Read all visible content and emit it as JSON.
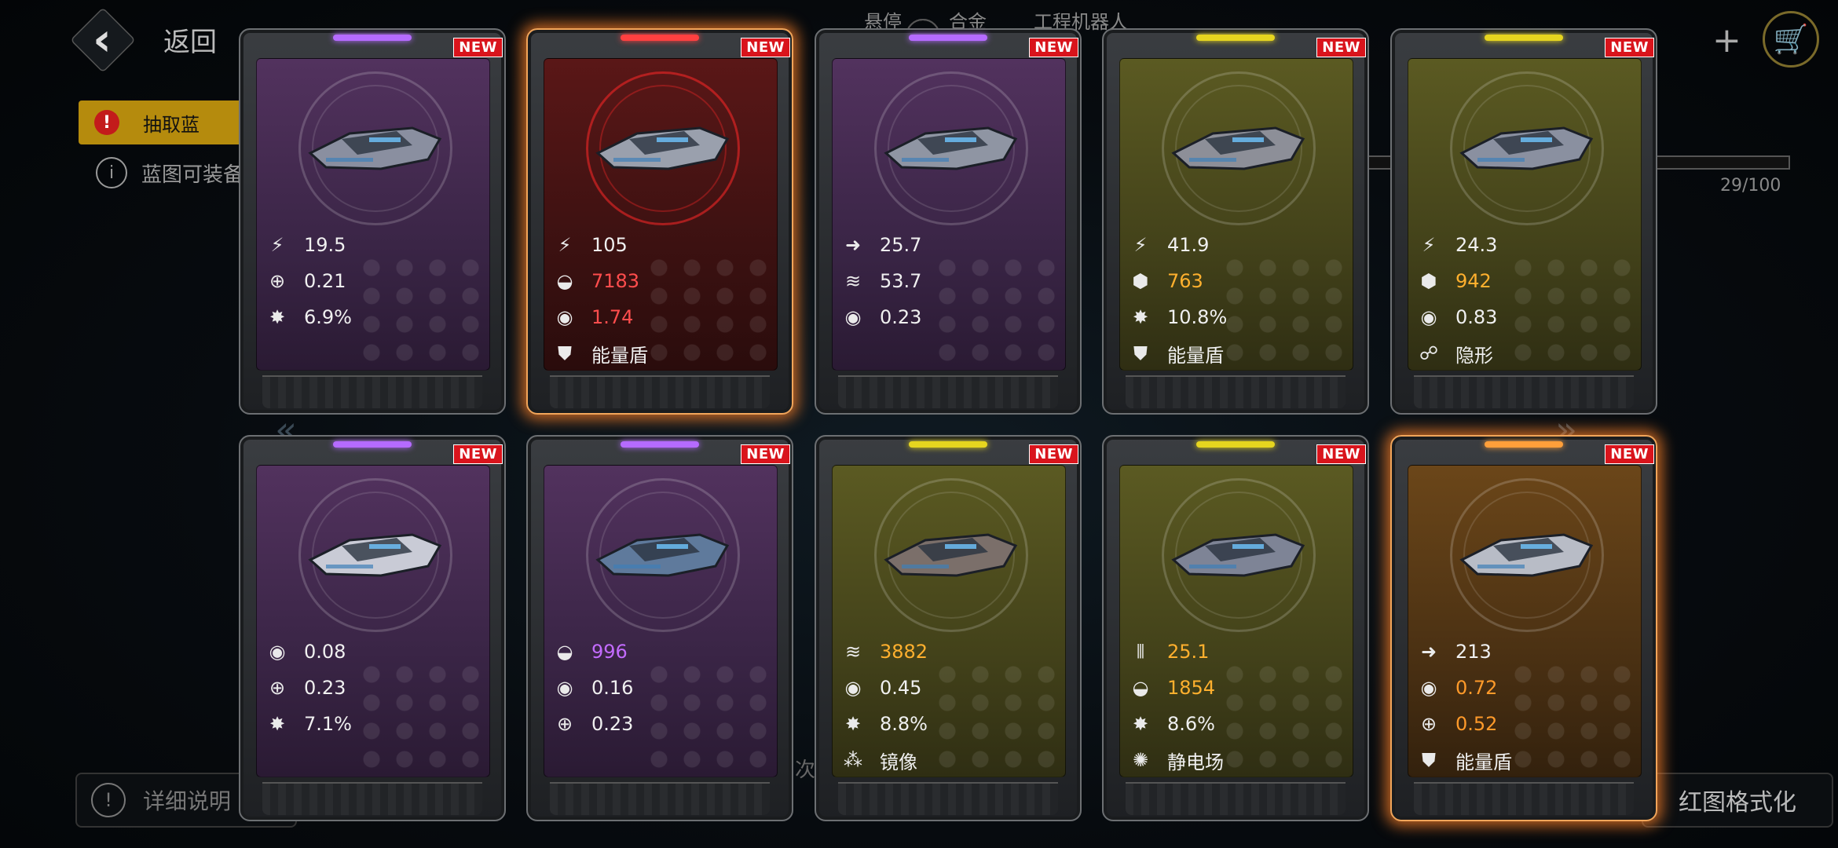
{
  "header": {
    "back_label": "返回",
    "tabs": [
      "悬停",
      "合金",
      "工程机器人"
    ],
    "plus": "+",
    "cart_icon": "cart-icon"
  },
  "background": {
    "warn_text": "抽取蓝",
    "info_text": "蓝图可装备",
    "progress_text": "29/100",
    "progress_value": 0.29,
    "help_label": "详细说明",
    "format_label": "红图格式化",
    "mid_text": "次"
  },
  "cards": [
    {
      "rarity": "purple",
      "glow": false,
      "new": "NEW",
      "ship_color": "#8a8fa0",
      "stats": [
        {
          "icon": "missile-icon",
          "glyph": "⚡",
          "value": "19.5",
          "color": "white"
        },
        {
          "icon": "crosshair-icon",
          "glyph": "⊕",
          "value": "0.21",
          "color": "white"
        },
        {
          "icon": "critical-icon",
          "glyph": "✸",
          "value": "6.9%",
          "color": "white"
        }
      ]
    },
    {
      "rarity": "red",
      "glow": true,
      "new": "NEW",
      "ship_color": "#9aa0ad",
      "stats": [
        {
          "icon": "missile-icon",
          "glyph": "⚡",
          "value": "105",
          "color": "white"
        },
        {
          "icon": "armor-icon",
          "glyph": "◒",
          "value": "7183",
          "color": "red"
        },
        {
          "icon": "shield-rate-icon",
          "glyph": "◉",
          "value": "1.74",
          "color": "red"
        },
        {
          "icon": "energy-shield-icon",
          "glyph": "⛊",
          "value": "能量盾",
          "color": "white"
        }
      ]
    },
    {
      "rarity": "purple",
      "glow": false,
      "new": "NEW",
      "ship_color": "#8f95a3",
      "stats": [
        {
          "icon": "speed-icon",
          "glyph": "➜",
          "value": "25.7",
          "color": "white"
        },
        {
          "icon": "cargo-icon",
          "glyph": "≋",
          "value": "53.7",
          "color": "white"
        },
        {
          "icon": "shield-rate-icon",
          "glyph": "◉",
          "value": "0.23",
          "color": "white"
        }
      ]
    },
    {
      "rarity": "yellow",
      "glow": false,
      "new": "NEW",
      "ship_color": "#8d8f98",
      "stats": [
        {
          "icon": "missile-icon",
          "glyph": "⚡",
          "value": "41.9",
          "color": "white"
        },
        {
          "icon": "hull-icon",
          "glyph": "⬢",
          "value": "763",
          "color": "orange"
        },
        {
          "icon": "critical-icon",
          "glyph": "✸",
          "value": "10.8%",
          "color": "white"
        },
        {
          "icon": "energy-shield-icon",
          "glyph": "⛊",
          "value": "能量盾",
          "color": "white"
        }
      ]
    },
    {
      "rarity": "yellow",
      "glow": false,
      "new": "NEW",
      "ship_color": "#8a90a0",
      "stats": [
        {
          "icon": "missile-icon",
          "glyph": "⚡",
          "value": "24.3",
          "color": "white"
        },
        {
          "icon": "hull-icon",
          "glyph": "⬢",
          "value": "942",
          "color": "orange"
        },
        {
          "icon": "shield-rate-icon",
          "glyph": "◉",
          "value": "0.83",
          "color": "white"
        },
        {
          "icon": "stealth-icon",
          "glyph": "☍",
          "value": "隐形",
          "color": "white"
        }
      ]
    },
    {
      "rarity": "purple",
      "glow": false,
      "new": "NEW",
      "ship_color": "#c9cbd6",
      "stats": [
        {
          "icon": "shield-rate-icon",
          "glyph": "◉",
          "value": "0.08",
          "color": "white"
        },
        {
          "icon": "crosshair-icon",
          "glyph": "⊕",
          "value": "0.23",
          "color": "white"
        },
        {
          "icon": "critical-icon",
          "glyph": "✸",
          "value": "7.1%",
          "color": "white"
        }
      ]
    },
    {
      "rarity": "purple",
      "glow": false,
      "new": "NEW",
      "ship_color": "#5f7a9c",
      "stats": [
        {
          "icon": "armor-icon",
          "glyph": "◒",
          "value": "996",
          "color": "purple"
        },
        {
          "icon": "shield-rate-icon",
          "glyph": "◉",
          "value": "0.16",
          "color": "white"
        },
        {
          "icon": "crosshair-icon",
          "glyph": "⊕",
          "value": "0.23",
          "color": "white"
        }
      ]
    },
    {
      "rarity": "yellow",
      "glow": false,
      "new": "NEW",
      "ship_color": "#7b6f6a",
      "stats": [
        {
          "icon": "cargo-icon",
          "glyph": "≋",
          "value": "3882",
          "color": "orange"
        },
        {
          "icon": "shield-rate-icon",
          "glyph": "◉",
          "value": "0.45",
          "color": "white"
        },
        {
          "icon": "critical-icon",
          "glyph": "✸",
          "value": "8.8%",
          "color": "white"
        },
        {
          "icon": "mirror-icon",
          "glyph": "⁂",
          "value": "镜像",
          "color": "white"
        }
      ]
    },
    {
      "rarity": "yellow",
      "glow": false,
      "new": "NEW",
      "ship_color": "#7e8496",
      "stats": [
        {
          "icon": "ammo-icon",
          "glyph": "⦀",
          "value": "25.1",
          "color": "orange"
        },
        {
          "icon": "armor-icon",
          "glyph": "◒",
          "value": "1854",
          "color": "orange"
        },
        {
          "icon": "critical-icon",
          "glyph": "✸",
          "value": "8.6%",
          "color": "white"
        },
        {
          "icon": "static-field-icon",
          "glyph": "✺",
          "value": "静电场",
          "color": "white"
        }
      ]
    },
    {
      "rarity": "orange",
      "glow": true,
      "new": "NEW",
      "ship_color": "#b8bcc6",
      "stats": [
        {
          "icon": "speed-icon",
          "glyph": "➜",
          "value": "213",
          "color": "white"
        },
        {
          "icon": "shield-rate-icon",
          "glyph": "◉",
          "value": "0.72",
          "color": "amber"
        },
        {
          "icon": "crosshair-icon",
          "glyph": "⊕",
          "value": "0.52",
          "color": "amber"
        },
        {
          "icon": "energy-shield-icon",
          "glyph": "⛊",
          "value": "能量盾",
          "color": "white"
        }
      ]
    }
  ],
  "colors": {
    "purple_bar": "#b56bff",
    "red_bar": "#ff4040",
    "yellow_bar": "#e6d51f",
    "orange_bar": "#ff9f3a"
  }
}
